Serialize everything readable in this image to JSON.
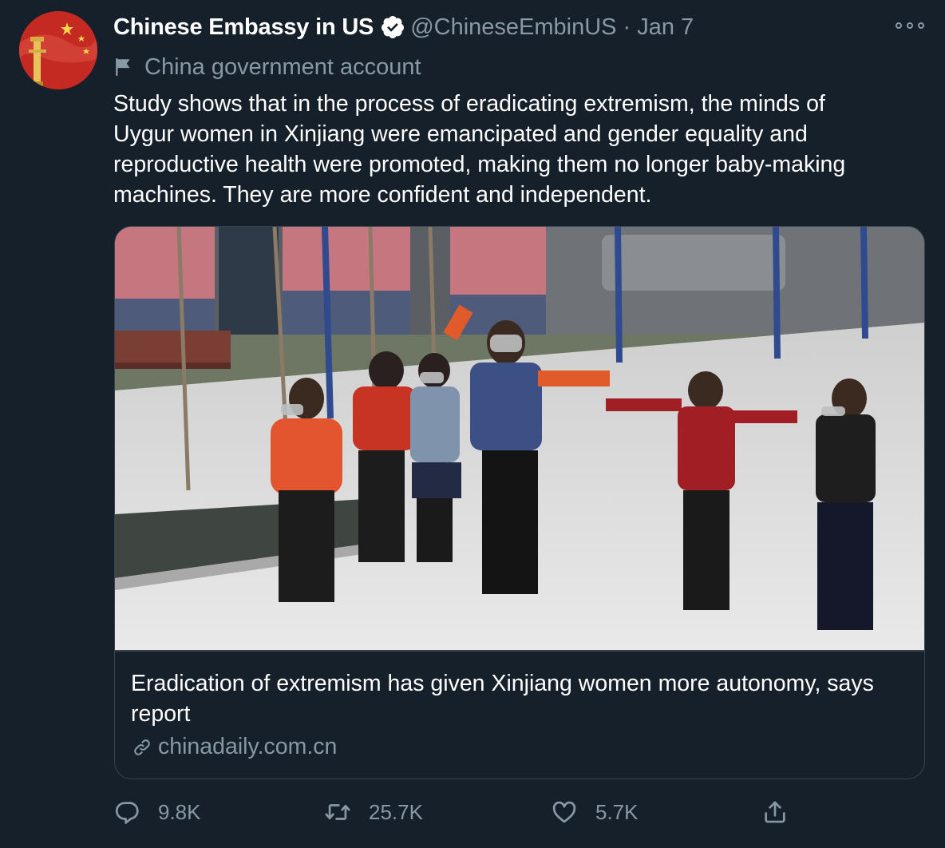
{
  "tweet": {
    "display_name": "Chinese Embassy in US",
    "handle": "@ChineseEmbinUS",
    "separator": "·",
    "date": "Jan 7",
    "label": "China government account",
    "text": "Study shows that in the process of eradicating extremism, the minds of\nUygur women in Xinjiang were emancipated and gender equality and\nreproductive health were promoted, making them no longer baby-making\nmachines. They are more confident and independent."
  },
  "card": {
    "title": "Eradication of extremism has given Xinjiang women more autonomy, says report",
    "domain": "chinadaily.com.cn"
  },
  "actions": {
    "replies": "9.8K",
    "retweets": "25.7K",
    "likes": "5.7K"
  },
  "icons": {
    "verified": "verified-badge-icon",
    "label": "flag-icon",
    "more": "more-options-icon",
    "link": "link-icon",
    "reply": "reply-icon",
    "retweet": "retweet-icon",
    "like": "heart-icon",
    "share": "share-icon"
  },
  "colors": {
    "background": "#15202b",
    "text": "#ffffff",
    "secondary": "#8899a6",
    "border": "#38444d"
  }
}
